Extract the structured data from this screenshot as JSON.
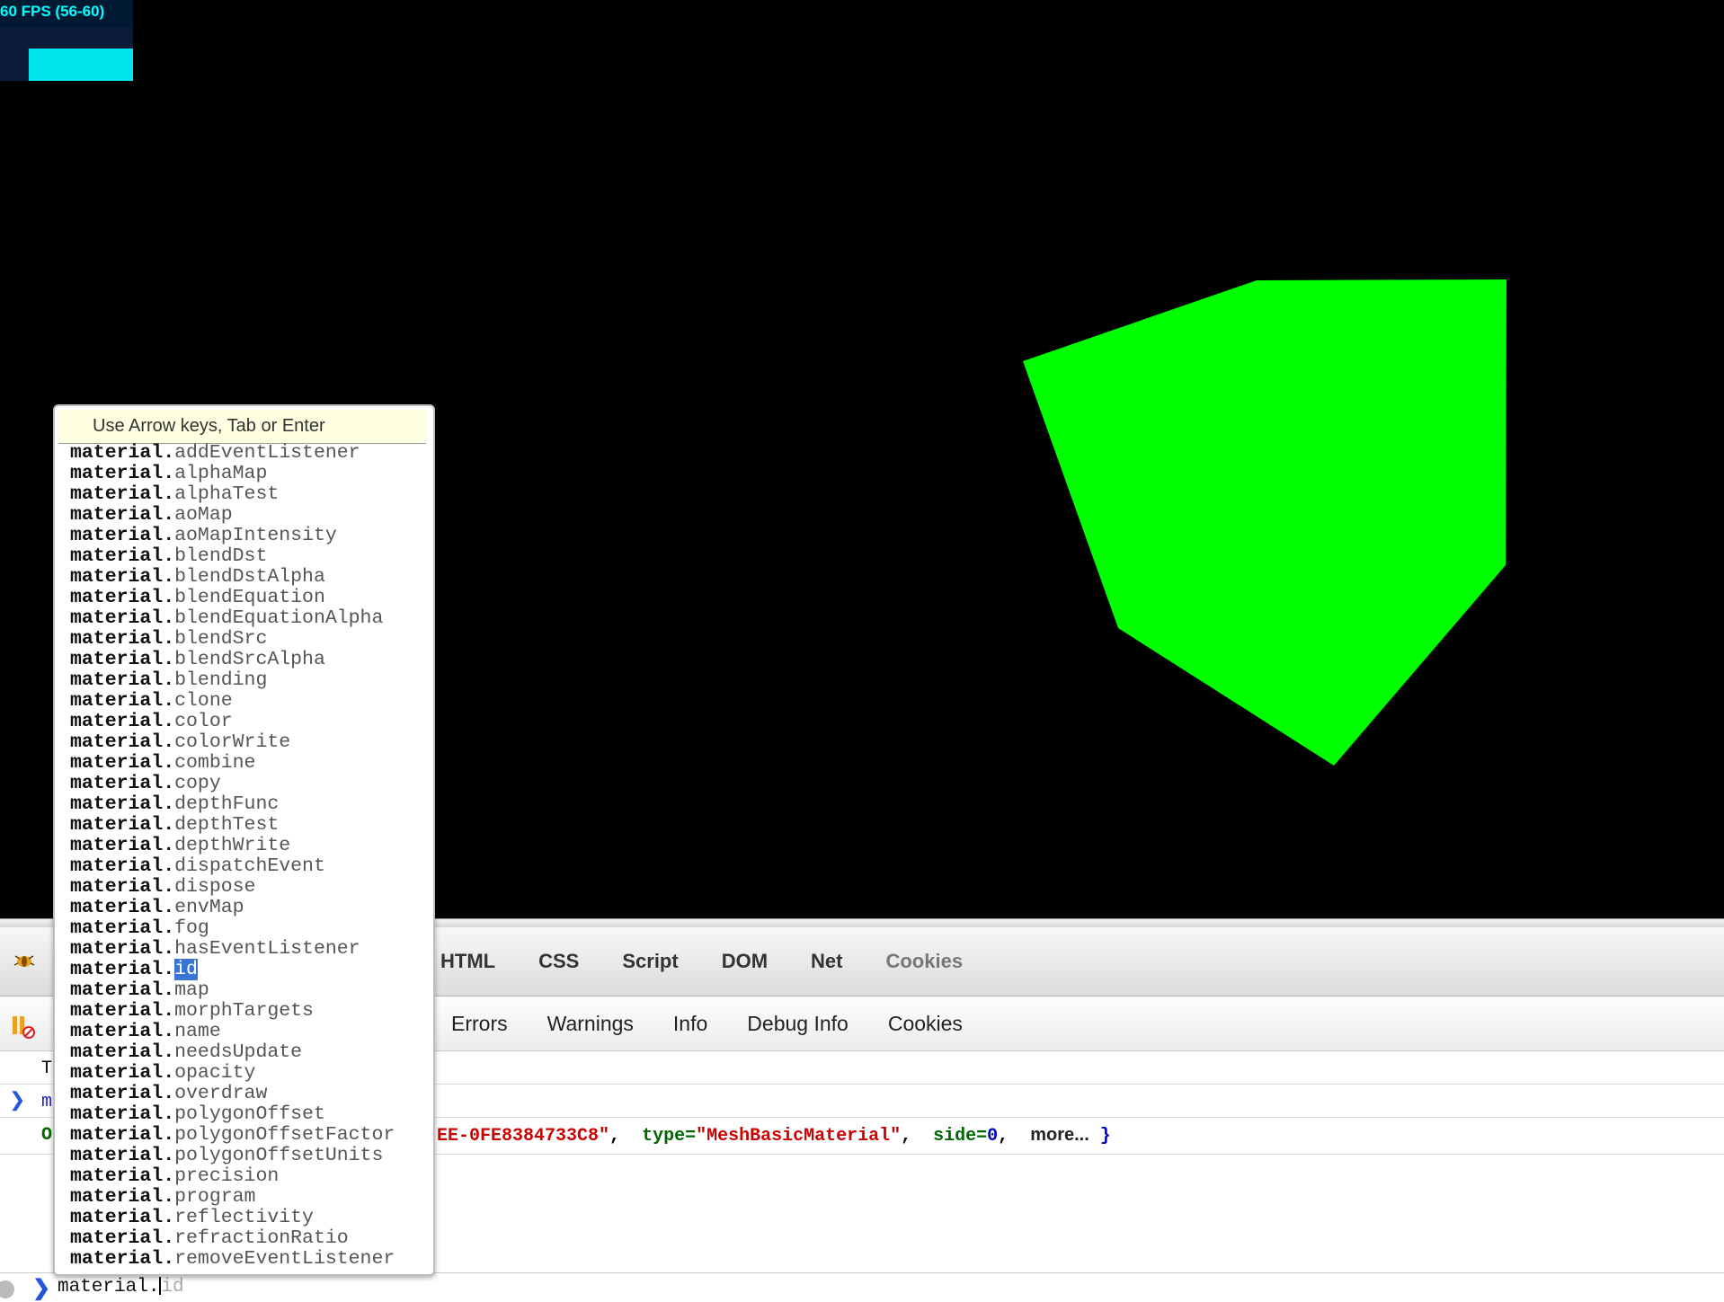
{
  "scene": {
    "fps_label": "60 FPS (56-60)",
    "background_color": "#000000",
    "cube_color": "#00ff00"
  },
  "autocomplete": {
    "header": "Use Arrow keys, Tab or Enter",
    "prefix": "material.",
    "selected_index": 25,
    "items": [
      "addEventListener",
      "alphaMap",
      "alphaTest",
      "aoMap",
      "aoMapIntensity",
      "blendDst",
      "blendDstAlpha",
      "blendEquation",
      "blendEquationAlpha",
      "blendSrc",
      "blendSrcAlpha",
      "blending",
      "clone",
      "color",
      "colorWrite",
      "combine",
      "copy",
      "depthFunc",
      "depthTest",
      "depthWrite",
      "dispatchEvent",
      "dispose",
      "envMap",
      "fog",
      "hasEventListener",
      "id",
      "map",
      "morphTargets",
      "name",
      "needsUpdate",
      "opacity",
      "overdraw",
      "polygonOffset",
      "polygonOffsetFactor",
      "polygonOffsetUnits",
      "precision",
      "program",
      "reflectivity",
      "refractionRatio",
      "removeEventListener"
    ]
  },
  "firebug": {
    "main_tabs": [
      "HTML",
      "CSS",
      "Script",
      "DOM",
      "Net",
      "Cookies"
    ],
    "console_filters": [
      "Errors",
      "Warnings",
      "Info",
      "Debug Info",
      "Cookies"
    ],
    "log": {
      "row1_text": "T",
      "row2_text": "m",
      "row3_text": "O",
      "uuid_tail": "\"EE-0FE8384733C8\"",
      "type_key": "type=",
      "type_value": "\"MeshBasicMaterial\"",
      "side_key": "side=",
      "side_value": "0",
      "more_link": "more...",
      "close_brace": "}"
    },
    "command_line": {
      "prompt": "❯",
      "typed": "material.",
      "completion_hint": "id"
    }
  },
  "colors": {
    "fps_text": "#00ffff",
    "selection": "#3875d7",
    "tooltip_bg": "#ffffe1"
  }
}
